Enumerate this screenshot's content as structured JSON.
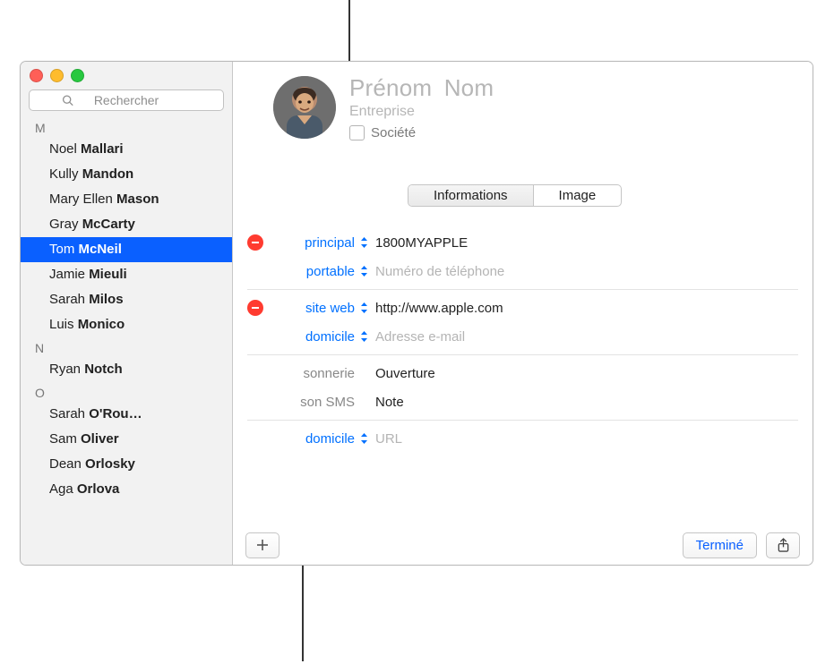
{
  "icons": {
    "close": "close-icon",
    "minimize": "minimize-icon",
    "maximize": "maximize-icon",
    "search": "search-icon"
  },
  "search": {
    "placeholder": "Rechercher"
  },
  "sidebar": {
    "sections": [
      {
        "letter": "M",
        "contacts": [
          {
            "first": "Noel",
            "last": "Mallari",
            "selected": false
          },
          {
            "first": "Kully",
            "last": "Mandon",
            "selected": false
          },
          {
            "first": "Mary Ellen",
            "last": "Mason",
            "selected": false
          },
          {
            "first": "Gray",
            "last": "McCarty",
            "selected": false
          },
          {
            "first": "Tom",
            "last": "McNeil",
            "selected": true
          },
          {
            "first": "Jamie",
            "last": "Mieuli",
            "selected": false
          },
          {
            "first": "Sarah",
            "last": "Milos",
            "selected": false
          },
          {
            "first": "Luis",
            "last": "Monico",
            "selected": false
          }
        ]
      },
      {
        "letter": "N",
        "contacts": [
          {
            "first": "Ryan",
            "last": "Notch",
            "selected": false
          }
        ]
      },
      {
        "letter": "O",
        "contacts": [
          {
            "first": "Sarah",
            "last": "O'Rou…",
            "selected": false
          },
          {
            "first": "Sam",
            "last": "Oliver",
            "selected": false
          },
          {
            "first": "Dean",
            "last": "Orlosky",
            "selected": false
          },
          {
            "first": "Aga",
            "last": "Orlova",
            "selected": false
          }
        ]
      }
    ]
  },
  "card": {
    "firstname_placeholder": "Prénom",
    "lastname_placeholder": "Nom",
    "company_placeholder": "Entreprise",
    "company_checkbox_label": "Société",
    "tabs": {
      "info": "Informations",
      "image": "Image"
    }
  },
  "fields": [
    {
      "type": "value",
      "removable": true,
      "label": "principal",
      "value": "1800MYAPPLE",
      "placeholder": "",
      "label_color": "link",
      "chevron": "blue"
    },
    {
      "type": "value",
      "removable": false,
      "label": "portable",
      "value": "",
      "placeholder": "Numéro de téléphone",
      "label_color": "link",
      "chevron": "blue"
    },
    {
      "type": "sep"
    },
    {
      "type": "value",
      "removable": true,
      "label": "site web",
      "value": "http://www.apple.com",
      "placeholder": "",
      "label_color": "link",
      "chevron": "blue"
    },
    {
      "type": "value",
      "removable": false,
      "label": "domicile",
      "value": "",
      "placeholder": "Adresse e-mail",
      "label_color": "link",
      "chevron": "blue"
    },
    {
      "type": "sep"
    },
    {
      "type": "popup",
      "removable": false,
      "label": "sonnerie",
      "popup_value": "Ouverture",
      "label_color": "plain"
    },
    {
      "type": "popup",
      "removable": false,
      "label": "son SMS",
      "popup_value": "Note",
      "label_color": "plain"
    },
    {
      "type": "sep"
    },
    {
      "type": "value",
      "removable": false,
      "label": "domicile",
      "value": "",
      "placeholder": "URL",
      "label_color": "link",
      "chevron": "blue"
    }
  ],
  "footer": {
    "add": "add-field",
    "done": "Terminé",
    "share": "share"
  }
}
